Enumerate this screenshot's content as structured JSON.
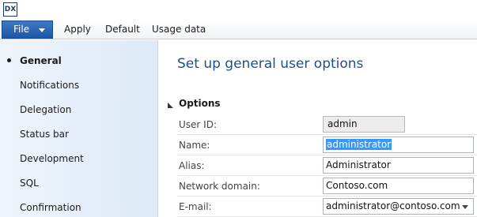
{
  "app": {
    "icon": "app-logo-icon",
    "icon_text": "DX"
  },
  "menu": {
    "file_label": "File",
    "items": [
      {
        "label": "Apply"
      },
      {
        "label": "Default"
      },
      {
        "label": "Usage data"
      }
    ]
  },
  "nav": {
    "items": [
      {
        "label": "General",
        "active": true
      },
      {
        "label": "Notifications"
      },
      {
        "label": "Delegation"
      },
      {
        "label": "Status bar"
      },
      {
        "label": "Development"
      },
      {
        "label": "SQL"
      },
      {
        "label": "Confirmation"
      }
    ]
  },
  "main": {
    "title": "Set up general user options",
    "section": "Options",
    "fields": [
      {
        "label": "User ID:",
        "value": "admin"
      },
      {
        "label": "Name:",
        "value": "administrator"
      },
      {
        "label": "Alias:",
        "value": "Administrator"
      },
      {
        "label": "Network domain:",
        "value": "Contoso.com"
      },
      {
        "label": "E-mail:",
        "value": "administrator@contoso.com"
      }
    ]
  },
  "colors": {
    "accent": "#1e56a8",
    "title": "#1e4e8c",
    "selection": "#3399ff"
  }
}
